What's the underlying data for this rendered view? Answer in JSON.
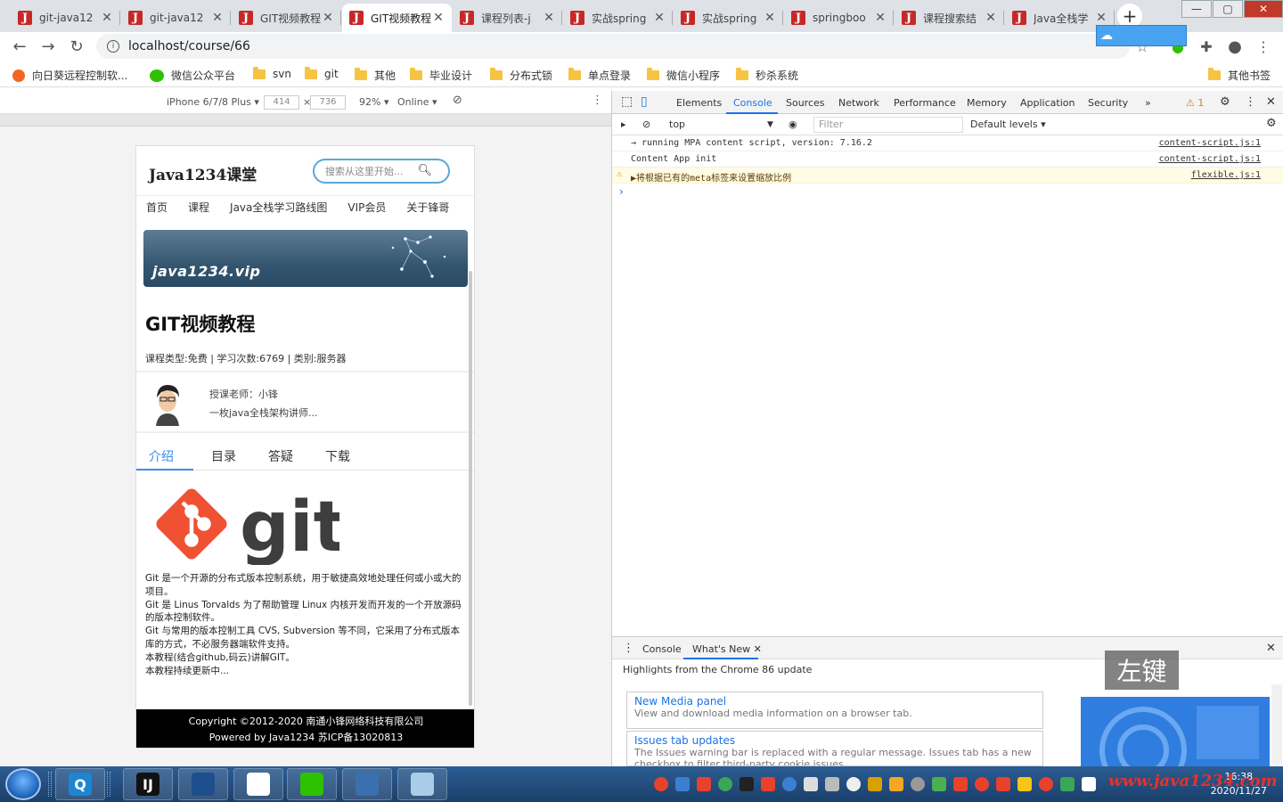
{
  "browser": {
    "tabs": [
      {
        "title": "git-java12",
        "active": false
      },
      {
        "title": "git-java12",
        "active": false
      },
      {
        "title": "GIT视频教程",
        "active": false
      },
      {
        "title": "GIT视频教程",
        "active": true
      },
      {
        "title": "课程列表-j",
        "active": false
      },
      {
        "title": "实战spring",
        "active": false
      },
      {
        "title": "实战spring",
        "active": false
      },
      {
        "title": "springboo",
        "active": false
      },
      {
        "title": "课程搜索结",
        "active": false
      },
      {
        "title": "Java全栈学",
        "active": false
      }
    ],
    "tab_favicon_letter": "J",
    "close_glyph": "✕",
    "new_tab_glyph": "+",
    "url": "localhost/course/66",
    "bookmarks": [
      {
        "label": "向日葵远程控制软...",
        "icon": "sunflower-icon"
      },
      {
        "label": "微信公众平台",
        "icon": "wechat-icon"
      },
      {
        "label": "svn",
        "icon": "folder-icon"
      },
      {
        "label": "git",
        "icon": "folder-icon"
      },
      {
        "label": "其他",
        "icon": "folder-icon"
      },
      {
        "label": "毕业设计",
        "icon": "folder-icon"
      },
      {
        "label": "分布式锁",
        "icon": "folder-icon"
      },
      {
        "label": "单点登录",
        "icon": "folder-icon"
      },
      {
        "label": "微信小程序",
        "icon": "folder-icon"
      },
      {
        "label": "秒杀系统",
        "icon": "folder-icon"
      }
    ],
    "other_bookmarks": "其他书签"
  },
  "device_toolbar": {
    "device": "iPhone 6/7/8 Plus ▾",
    "width": "414",
    "times": "×",
    "height": "736",
    "zoom": "92% ▾",
    "network": "Online ▾"
  },
  "site": {
    "logo": "Java1234课堂",
    "search_placeholder": "搜索从这里开始...",
    "nav": [
      "首页",
      "课程",
      "Java全栈学习路线图",
      "VIP会员",
      "关于锋哥"
    ],
    "banner_text": "java1234.vip",
    "course_title": "GIT视频教程",
    "course_meta": "课程类型:免费 | 学习次数:6769 | 类别:服务器",
    "teacher_name": "授课老师：小锋",
    "teacher_desc": "一枚java全栈架构讲师...",
    "course_tabs": [
      "介绍",
      "目录",
      "答疑",
      "下载"
    ],
    "git_wordmark": "git",
    "intro_lines": [
      "Git 是一个开源的分布式版本控制系统，用于敏捷高效地处理任何或小或大的项目。",
      "Git 是 Linus Torvalds 为了帮助管理 Linux 内核开发而开发的一个开放源码的版本控制软件。",
      "Git 与常用的版本控制工具 CVS, Subversion 等不同，它采用了分布式版本库的方式，不必服务器端软件支持。",
      "本教程(结合github,码云)讲解GIT。",
      "本教程持续更新中..."
    ],
    "footer_line1": "Copyright ©2012-2020 南通小锋网络科技有限公司",
    "footer_line2": "Powered by Java1234 苏ICP备13020813"
  },
  "devtools": {
    "tabs": [
      "Elements",
      "Console",
      "Sources",
      "Network",
      "Performance",
      "Memory",
      "Application",
      "Security"
    ],
    "active_tab": "Console",
    "more_glyph": "»",
    "warning_count": "⚠ 1",
    "context": "top",
    "filter_placeholder": "Filter",
    "levels": "Default levels ▾",
    "logs": [
      {
        "text": "→ running MPA content script, version: 7.16.2",
        "source": "content-script.js:1",
        "level": "info"
      },
      {
        "text": "Content App init",
        "source": "content-script.js:1",
        "level": "info"
      },
      {
        "text": "▶将根据已有的meta标签来设置缩放比例",
        "source": "flexible.js:1",
        "level": "warning"
      }
    ],
    "prompt": "›",
    "drawer_tabs": [
      "Console",
      "What's New"
    ],
    "drawer_heading": "Highlights from the Chrome 86 update",
    "cards": [
      {
        "title": "New Media panel",
        "desc": "View and download media information on a browser tab."
      },
      {
        "title": "Issues tab updates",
        "desc": "The Issues warning bar is replaced with a regular message. Issues tab has a new checkbox to filter third-party cookie issues."
      }
    ]
  },
  "overlay_key": "左键",
  "taskbar": {
    "apps": [
      "Q",
      "IJ",
      "",
      "",
      "",
      "",
      ""
    ],
    "clock_time": "16:38",
    "clock_date": "2020/11/27"
  },
  "watermark": "www.java1234.com",
  "colors": {
    "accent_blue": "#3a8ee6",
    "chrome_blue": "#1a73e8",
    "favicon_red": "#c62828",
    "footer_black": "#000000"
  }
}
